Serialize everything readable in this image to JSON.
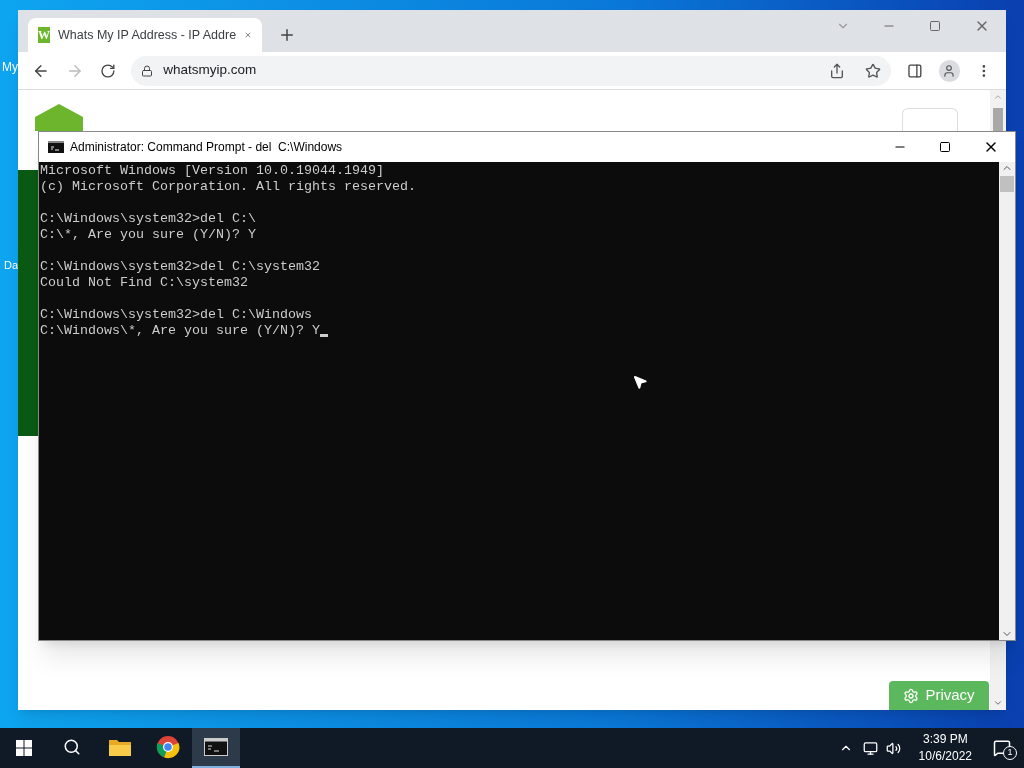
{
  "desktop_icons": [
    {
      "label": "My"
    },
    {
      "label": "Da"
    }
  ],
  "browser": {
    "tab": {
      "favicon_letter": "W",
      "title": "Whats My IP Address - IP Addre",
      "selected": true
    },
    "address": "whatsmyip.com",
    "page": {
      "privacy_button": "Privacy"
    }
  },
  "console": {
    "title": "Administrator: Command Prompt - del  C:\\Windows",
    "blocks": [
      [
        "Microsoft Windows [Version 10.0.19044.1949]",
        "(c) Microsoft Corporation. All rights reserved."
      ],
      [
        "C:\\Windows\\system32>del C:\\",
        "C:\\*, Are you sure (Y/N)? Y"
      ],
      [
        "C:\\Windows\\system32>del C:\\system32",
        "Could Not Find C:\\system32"
      ],
      [
        "C:\\Windows\\system32>del C:\\Windows",
        "C:\\Windows\\*, Are you sure (Y/N)? Y"
      ]
    ],
    "cursor": true
  },
  "taskbar": {
    "apps": [
      {
        "kind": "search",
        "selected": false
      },
      {
        "kind": "explorer",
        "selected": false
      },
      {
        "kind": "chrome",
        "selected": false
      },
      {
        "kind": "terminal",
        "selected": true
      }
    ],
    "time": "3:39 PM",
    "date": "10/6/2022",
    "notification_count": "1"
  }
}
